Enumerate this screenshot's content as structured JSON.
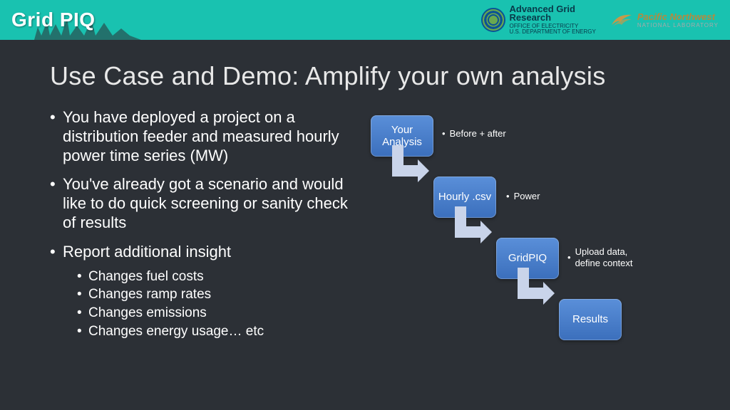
{
  "header": {
    "logo": "Grid PIQ",
    "agr_line1": "Advanced Grid",
    "agr_line2": "Research",
    "agr_sub1": "OFFICE OF ELECTRICITY",
    "agr_sub2": "U.S. DEPARTMENT OF ENERGY",
    "pnnl_line1": "Pacific Northwest",
    "pnnl_line2": "NATIONAL LABORATORY"
  },
  "title": "Use Case and Demo: Amplify your own analysis",
  "bullets": [
    "You have deployed a project on a distribution feeder and measured hourly power time series (MW)",
    "You've already got a scenario and would like to do quick screening or sanity check of results",
    "Report additional insight"
  ],
  "sub_bullets": [
    "Changes fuel costs",
    "Changes ramp rates",
    "Changes emissions",
    "Changes energy usage… etc"
  ],
  "flow": {
    "n1": "Your Analysis",
    "c1": "Before + after",
    "n2": "Hourly .csv",
    "c2": "Power",
    "n3": "GridPIQ",
    "c3": "Upload data, define context",
    "n4": "Results"
  }
}
